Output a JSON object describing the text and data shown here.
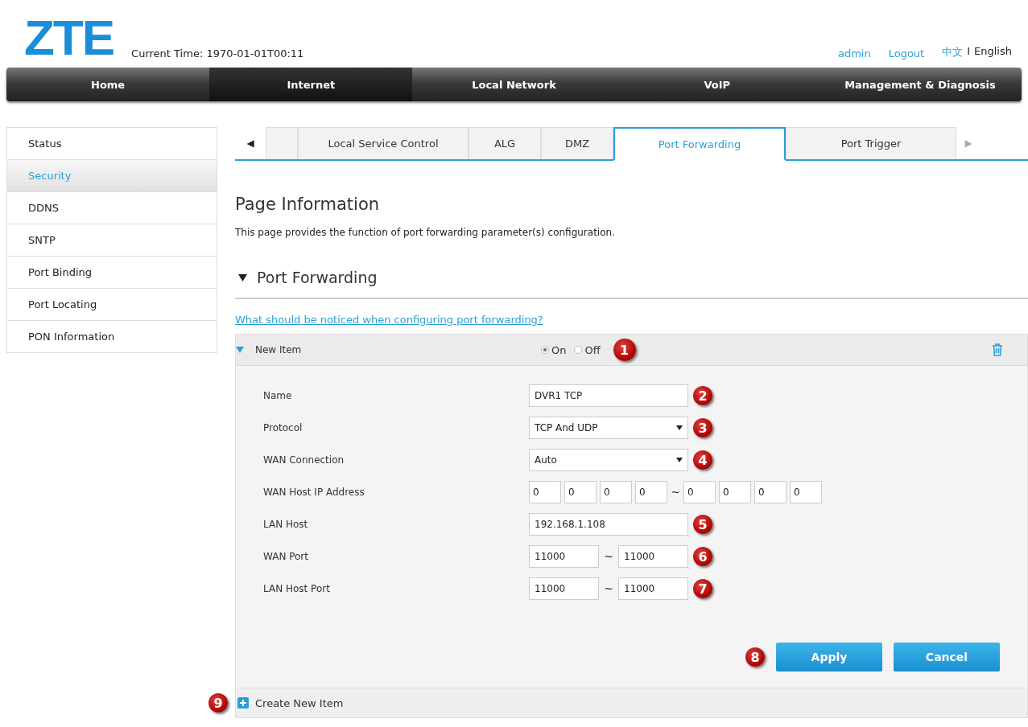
{
  "header": {
    "logo": "ZTE",
    "current_time": "Current Time: 1970-01-01T00:11",
    "user": "admin",
    "logout": "Logout",
    "languages": [
      {
        "label": "中文",
        "selected": false
      },
      {
        "label": "English",
        "selected": true
      }
    ],
    "language_separator": "I"
  },
  "nav": [
    {
      "label": "Home",
      "selected": false
    },
    {
      "label": "Internet",
      "selected": true
    },
    {
      "label": "Local Network",
      "selected": false
    },
    {
      "label": "VoIP",
      "selected": false
    },
    {
      "label": "Management & Diagnosis",
      "selected": false
    }
  ],
  "sidebar": {
    "items": [
      {
        "label": "Status",
        "selected": false
      },
      {
        "label": "Security",
        "selected": true
      },
      {
        "label": "DDNS",
        "selected": false
      },
      {
        "label": "SNTP",
        "selected": false
      },
      {
        "label": "Port Binding",
        "selected": false
      },
      {
        "label": "Port Locating",
        "selected": false
      },
      {
        "label": "PON Information",
        "selected": false
      }
    ]
  },
  "tabs": {
    "prev": "◀",
    "next": "▶",
    "items": [
      {
        "label": "Local Service Control",
        "selected": false
      },
      {
        "label": "ALG",
        "selected": false
      },
      {
        "label": "DMZ",
        "selected": false
      },
      {
        "label": "Port Forwarding",
        "selected": true
      },
      {
        "label": "Port Trigger",
        "selected": false
      }
    ]
  },
  "page_info": {
    "title": "Page Information",
    "description": "This page provides the function of port forwarding parameter(s) configuration."
  },
  "section": {
    "title": "Port Forwarding",
    "expanded": true,
    "help_link": "What should be noticed when configuring port forwarding?"
  },
  "item": {
    "title": "New Item",
    "expanded": true,
    "status": [
      {
        "label": "On",
        "selected": true
      },
      {
        "label": "Off",
        "selected": false
      }
    ],
    "callout": "1",
    "fields": [
      {
        "kind": "text",
        "label": "Name",
        "value": "DVR1 TCP",
        "callout": "2"
      },
      {
        "kind": "select",
        "label": "Protocol",
        "value": "TCP And UDP",
        "callout": "3"
      },
      {
        "kind": "select",
        "label": "WAN Connection",
        "value": "Auto",
        "callout": "4"
      },
      {
        "kind": "ip_range",
        "label": "WAN Host IP Address",
        "from": [
          "0",
          "0",
          "0",
          "0"
        ],
        "to": [
          "0",
          "0",
          "0",
          "0"
        ],
        "separator": "~"
      },
      {
        "kind": "text",
        "label": "LAN Host",
        "value": "192.168.1.108",
        "callout": "5"
      },
      {
        "kind": "range",
        "label": "WAN Port",
        "from": "11000",
        "to": "11000",
        "separator": "~",
        "callout": "6"
      },
      {
        "kind": "range",
        "label": "LAN Host Port",
        "from": "11000",
        "to": "11000",
        "separator": "~",
        "callout": "7"
      }
    ],
    "buttons": [
      {
        "label": "Apply",
        "callout": "8"
      },
      {
        "label": "Cancel"
      }
    ]
  },
  "create": {
    "label": "Create New Item",
    "callout": "9"
  }
}
